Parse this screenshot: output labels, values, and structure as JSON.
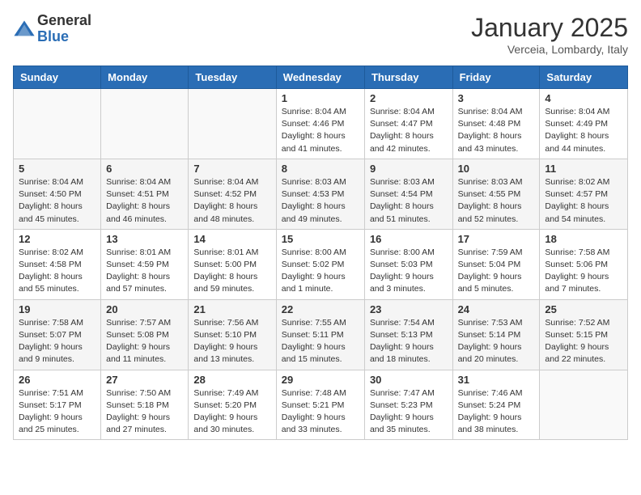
{
  "header": {
    "logo_general": "General",
    "logo_blue": "Blue",
    "month": "January 2025",
    "location": "Verceia, Lombardy, Italy"
  },
  "weekdays": [
    "Sunday",
    "Monday",
    "Tuesday",
    "Wednesday",
    "Thursday",
    "Friday",
    "Saturday"
  ],
  "weeks": [
    [
      {
        "day": "",
        "info": ""
      },
      {
        "day": "",
        "info": ""
      },
      {
        "day": "",
        "info": ""
      },
      {
        "day": "1",
        "info": "Sunrise: 8:04 AM\nSunset: 4:46 PM\nDaylight: 8 hours\nand 41 minutes."
      },
      {
        "day": "2",
        "info": "Sunrise: 8:04 AM\nSunset: 4:47 PM\nDaylight: 8 hours\nand 42 minutes."
      },
      {
        "day": "3",
        "info": "Sunrise: 8:04 AM\nSunset: 4:48 PM\nDaylight: 8 hours\nand 43 minutes."
      },
      {
        "day": "4",
        "info": "Sunrise: 8:04 AM\nSunset: 4:49 PM\nDaylight: 8 hours\nand 44 minutes."
      }
    ],
    [
      {
        "day": "5",
        "info": "Sunrise: 8:04 AM\nSunset: 4:50 PM\nDaylight: 8 hours\nand 45 minutes."
      },
      {
        "day": "6",
        "info": "Sunrise: 8:04 AM\nSunset: 4:51 PM\nDaylight: 8 hours\nand 46 minutes."
      },
      {
        "day": "7",
        "info": "Sunrise: 8:04 AM\nSunset: 4:52 PM\nDaylight: 8 hours\nand 48 minutes."
      },
      {
        "day": "8",
        "info": "Sunrise: 8:03 AM\nSunset: 4:53 PM\nDaylight: 8 hours\nand 49 minutes."
      },
      {
        "day": "9",
        "info": "Sunrise: 8:03 AM\nSunset: 4:54 PM\nDaylight: 8 hours\nand 51 minutes."
      },
      {
        "day": "10",
        "info": "Sunrise: 8:03 AM\nSunset: 4:55 PM\nDaylight: 8 hours\nand 52 minutes."
      },
      {
        "day": "11",
        "info": "Sunrise: 8:02 AM\nSunset: 4:57 PM\nDaylight: 8 hours\nand 54 minutes."
      }
    ],
    [
      {
        "day": "12",
        "info": "Sunrise: 8:02 AM\nSunset: 4:58 PM\nDaylight: 8 hours\nand 55 minutes."
      },
      {
        "day": "13",
        "info": "Sunrise: 8:01 AM\nSunset: 4:59 PM\nDaylight: 8 hours\nand 57 minutes."
      },
      {
        "day": "14",
        "info": "Sunrise: 8:01 AM\nSunset: 5:00 PM\nDaylight: 8 hours\nand 59 minutes."
      },
      {
        "day": "15",
        "info": "Sunrise: 8:00 AM\nSunset: 5:02 PM\nDaylight: 9 hours\nand 1 minute."
      },
      {
        "day": "16",
        "info": "Sunrise: 8:00 AM\nSunset: 5:03 PM\nDaylight: 9 hours\nand 3 minutes."
      },
      {
        "day": "17",
        "info": "Sunrise: 7:59 AM\nSunset: 5:04 PM\nDaylight: 9 hours\nand 5 minutes."
      },
      {
        "day": "18",
        "info": "Sunrise: 7:58 AM\nSunset: 5:06 PM\nDaylight: 9 hours\nand 7 minutes."
      }
    ],
    [
      {
        "day": "19",
        "info": "Sunrise: 7:58 AM\nSunset: 5:07 PM\nDaylight: 9 hours\nand 9 minutes."
      },
      {
        "day": "20",
        "info": "Sunrise: 7:57 AM\nSunset: 5:08 PM\nDaylight: 9 hours\nand 11 minutes."
      },
      {
        "day": "21",
        "info": "Sunrise: 7:56 AM\nSunset: 5:10 PM\nDaylight: 9 hours\nand 13 minutes."
      },
      {
        "day": "22",
        "info": "Sunrise: 7:55 AM\nSunset: 5:11 PM\nDaylight: 9 hours\nand 15 minutes."
      },
      {
        "day": "23",
        "info": "Sunrise: 7:54 AM\nSunset: 5:13 PM\nDaylight: 9 hours\nand 18 minutes."
      },
      {
        "day": "24",
        "info": "Sunrise: 7:53 AM\nSunset: 5:14 PM\nDaylight: 9 hours\nand 20 minutes."
      },
      {
        "day": "25",
        "info": "Sunrise: 7:52 AM\nSunset: 5:15 PM\nDaylight: 9 hours\nand 22 minutes."
      }
    ],
    [
      {
        "day": "26",
        "info": "Sunrise: 7:51 AM\nSunset: 5:17 PM\nDaylight: 9 hours\nand 25 minutes."
      },
      {
        "day": "27",
        "info": "Sunrise: 7:50 AM\nSunset: 5:18 PM\nDaylight: 9 hours\nand 27 minutes."
      },
      {
        "day": "28",
        "info": "Sunrise: 7:49 AM\nSunset: 5:20 PM\nDaylight: 9 hours\nand 30 minutes."
      },
      {
        "day": "29",
        "info": "Sunrise: 7:48 AM\nSunset: 5:21 PM\nDaylight: 9 hours\nand 33 minutes."
      },
      {
        "day": "30",
        "info": "Sunrise: 7:47 AM\nSunset: 5:23 PM\nDaylight: 9 hours\nand 35 minutes."
      },
      {
        "day": "31",
        "info": "Sunrise: 7:46 AM\nSunset: 5:24 PM\nDaylight: 9 hours\nand 38 minutes."
      },
      {
        "day": "",
        "info": ""
      }
    ]
  ]
}
